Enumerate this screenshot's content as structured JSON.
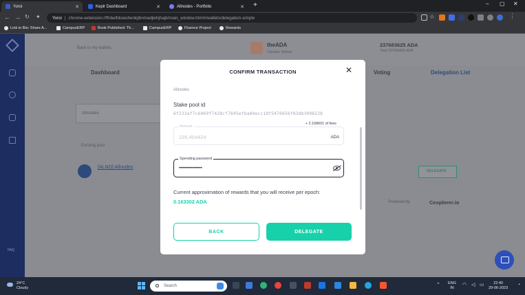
{
  "browser": {
    "tabs": [
      {
        "title": "Yoroi",
        "active": true,
        "color": "#3a5cc7"
      },
      {
        "title": "Keplr Dashboard",
        "active": false,
        "color": "#2f5fe6"
      },
      {
        "title": "Allnodes - Portfolio",
        "active": false,
        "color": "#7c7cf0"
      }
    ],
    "new_tab": "+",
    "window_controls": [
      "–",
      "▢",
      "✕"
    ],
    "omnibox": {
      "host": "Yoroi",
      "url": "chrome-extension://ffnbelfdoeiohenkjibnmadjiehjhajb/main_window.html#/wallets/delegation-simple"
    },
    "bookmarks": [
      "Link in Bio: Share A...",
      "CampusERP",
      "Book Published: Th...",
      "CampusERP",
      "Fluence Project",
      "Rewards"
    ]
  },
  "background": {
    "back_to_wallets": "Back to my wallets",
    "wallet_name": "theADA",
    "wallet_sub": "Cardano Testnet",
    "balance": "237683625 ADA",
    "balance_sub": "Total 237683625 ADA",
    "nav": [
      "Dashboard",
      "Voting",
      "Delegation List"
    ],
    "filter_label": "Allnodes",
    "pool_label": "Existing pool",
    "pool_name": "[ALNO] Allnodes",
    "delegate_btn": "DELEGATE",
    "powered_by": "Powered by",
    "explorer": "Cexplorer.io"
  },
  "modal": {
    "title": "CONFIRM TRANSACTION",
    "network": "Allnodes",
    "stake_pool_label": "Stake pool id",
    "stake_pool_id": "6f223af7c6069f7428cf7695efba84ecc18f5476656f83db3996228",
    "fees": "+ 2.168601 of fees",
    "amount_label": "Amount",
    "amount_value": "235.454424",
    "amount_currency": "ADA",
    "password_label": "Spending password",
    "password_value": "•••••••••••••••••",
    "approx_text": "Current approximation of rewards that you will receive per epoch:",
    "reward_value": "0.163302 ADA",
    "back_label": "BACK",
    "delegate_label": "DELEGATE"
  },
  "taskbar": {
    "weather_temp": "24°C",
    "weather_desc": "Cloudy",
    "search_placeholder": "Search",
    "lang": "ENG",
    "region": "IN",
    "time": "22:40",
    "date": "29-06-2023"
  },
  "colors": {
    "accent": "#17d1aa",
    "sidebar": "#1e2d60",
    "chat": "#2d4fba"
  }
}
